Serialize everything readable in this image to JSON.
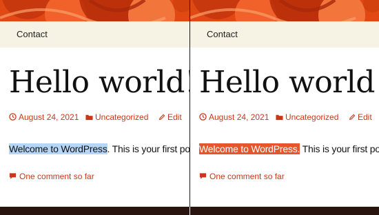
{
  "colors": {
    "banner_base": "#e04a12",
    "nav_background": "#f6f3e4",
    "accent_link": "#c9371b",
    "selection_left": "#b5d6f6",
    "selection_right": "#e4562d",
    "footer": "#2a1410"
  },
  "panels": [
    {
      "nav": {
        "contact_label": "Contact"
      },
      "post": {
        "title": "Hello world!",
        "date_icon": "clock-icon",
        "date": "August 24, 2021",
        "category_icon": "folder-icon",
        "category": "Uncategorized",
        "edit_icon": "pencil-icon",
        "edit_label": "Edit",
        "highlighted_text": "Welcome to WordPress",
        "rest_text": ". This is your first post.",
        "comments_icon": "speech-bubble-icon",
        "comments_label": "One comment so far"
      }
    },
    {
      "nav": {
        "contact_label": "Contact"
      },
      "post": {
        "title": "Hello world!",
        "date_icon": "clock-icon",
        "date": "August 24, 2021",
        "category_icon": "folder-icon",
        "category": "Uncategorized",
        "edit_icon": "pencil-icon",
        "edit_label": "Edit",
        "highlighted_text": "Welcome to WordPress.",
        "rest_text": " This is your first post.",
        "comments_icon": "speech-bubble-icon",
        "comments_label": "One comment so far"
      }
    }
  ]
}
